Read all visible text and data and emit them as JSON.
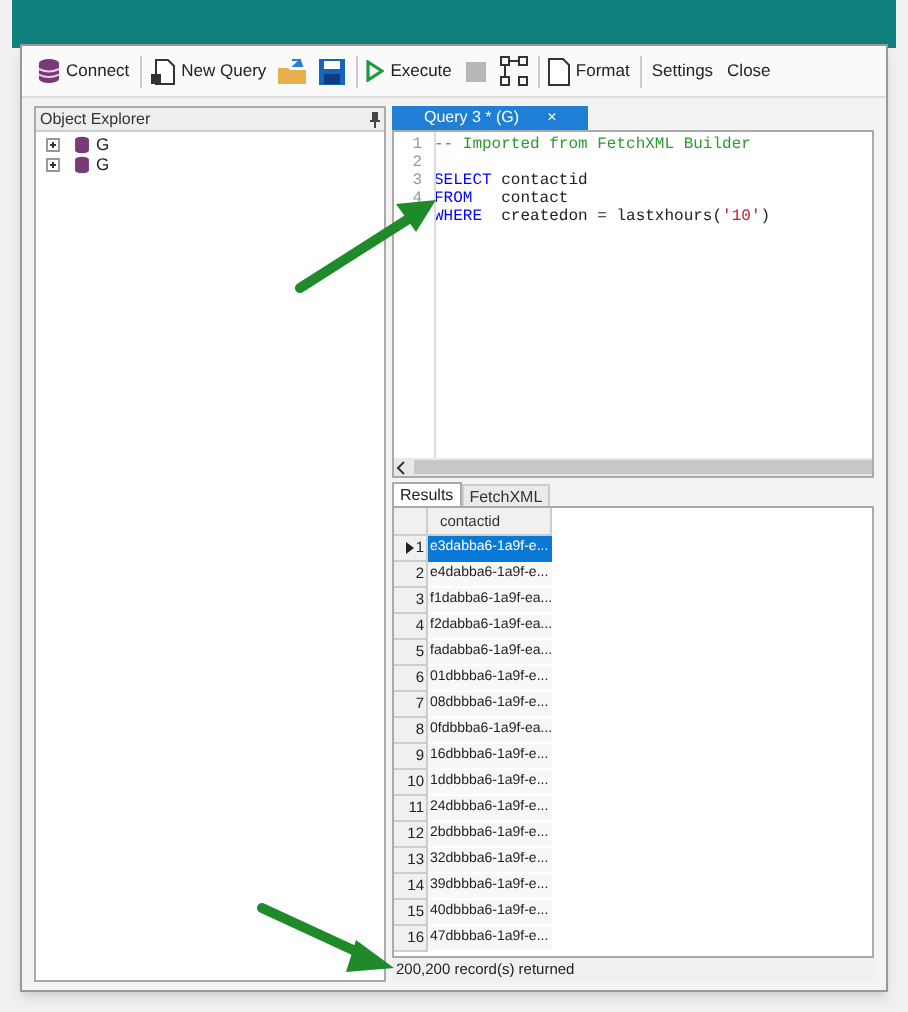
{
  "toolbar": [
    {
      "kind": "labeled",
      "label": "Connect"
    },
    {
      "kind": "labeled",
      "label": "New Query"
    },
    {
      "kind": "icon"
    },
    {
      "kind": "icon"
    },
    {
      "kind": "labeled",
      "label": "Execute"
    },
    {
      "kind": "icon",
      "disabled": true
    },
    {
      "kind": "icon"
    },
    {
      "kind": "labeled",
      "label": "Format"
    },
    {
      "kind": "text",
      "label": "Settings"
    },
    {
      "kind": "text",
      "label": "Close"
    }
  ],
  "object_explorer": {
    "title": "Object Explorer",
    "items": [
      {
        "label": "G",
        "expanded": false
      },
      {
        "label": "G",
        "expanded": false
      }
    ]
  },
  "editor": {
    "tab": {
      "label": "Query 3 * (G)",
      "close": "×"
    },
    "lines": [
      {
        "number": "1",
        "tokens": [
          {
            "kind": "comment",
            "text": "-- Imported from FetchXML Builder"
          }
        ]
      },
      {
        "number": "2"
      },
      {
        "number": "3",
        "tokens": [
          {
            "kind": "keyword",
            "text": "SELECT"
          },
          {
            "kind": "plain",
            "text": " contactid"
          }
        ]
      },
      {
        "number": "4",
        "tokens": [
          {
            "kind": "keyword",
            "text": "FROM"
          },
          {
            "kind": "plain",
            "text": "   contact"
          }
        ]
      },
      {
        "tokens": [
          {
            "kind": "keyword",
            "text": "WHERE"
          },
          {
            "kind": "plain",
            "text": "  createdon = lastxhours("
          },
          {
            "kind": "string",
            "text": "'10'"
          },
          {
            "kind": "plain",
            "text": ")"
          }
        ]
      }
    ]
  },
  "results": {
    "tabs": [
      {
        "label": "Results",
        "selected": true
      },
      {
        "label": "FetchXML",
        "selected": false
      }
    ],
    "column": "contactid",
    "rows": [
      {
        "number": "1",
        "value": "e3dabba6-1a9f-e...",
        "selected": true
      },
      {
        "number": "2",
        "value": "e4dabba6-1a9f-e...",
        "selected": false
      },
      {
        "number": "3",
        "value": "f1dabba6-1a9f-ea...",
        "selected": false
      },
      {
        "number": "4",
        "value": "f2dabba6-1a9f-ea...",
        "selected": false
      },
      {
        "number": "5",
        "value": "fadabba6-1a9f-ea...",
        "selected": false
      },
      {
        "number": "6",
        "value": "01dbbba6-1a9f-e...",
        "selected": false
      },
      {
        "number": "7",
        "value": "08dbbba6-1a9f-e...",
        "selected": false
      },
      {
        "number": "8",
        "value": "0fdbbba6-1a9f-ea...",
        "selected": false
      },
      {
        "number": "9",
        "value": "16dbbba6-1a9f-e...",
        "selected": false
      },
      {
        "number": "10",
        "value": "1ddbbba6-1a9f-e...",
        "selected": false
      },
      {
        "number": "11",
        "value": "24dbbba6-1a9f-e...",
        "selected": false
      },
      {
        "number": "12",
        "value": "2bdbbba6-1a9f-e...",
        "selected": false
      },
      {
        "number": "13",
        "value": "32dbbba6-1a9f-e...",
        "selected": false
      },
      {
        "number": "14",
        "value": "39dbbba6-1a9f-e...",
        "selected": false
      },
      {
        "number": "15",
        "value": "40dbbba6-1a9f-e...",
        "selected": false
      },
      {
        "number": "16",
        "value": "47dbbba6-1a9f-e...",
        "selected": false
      }
    ]
  },
  "status_bar": "200,200 record(s) returned"
}
